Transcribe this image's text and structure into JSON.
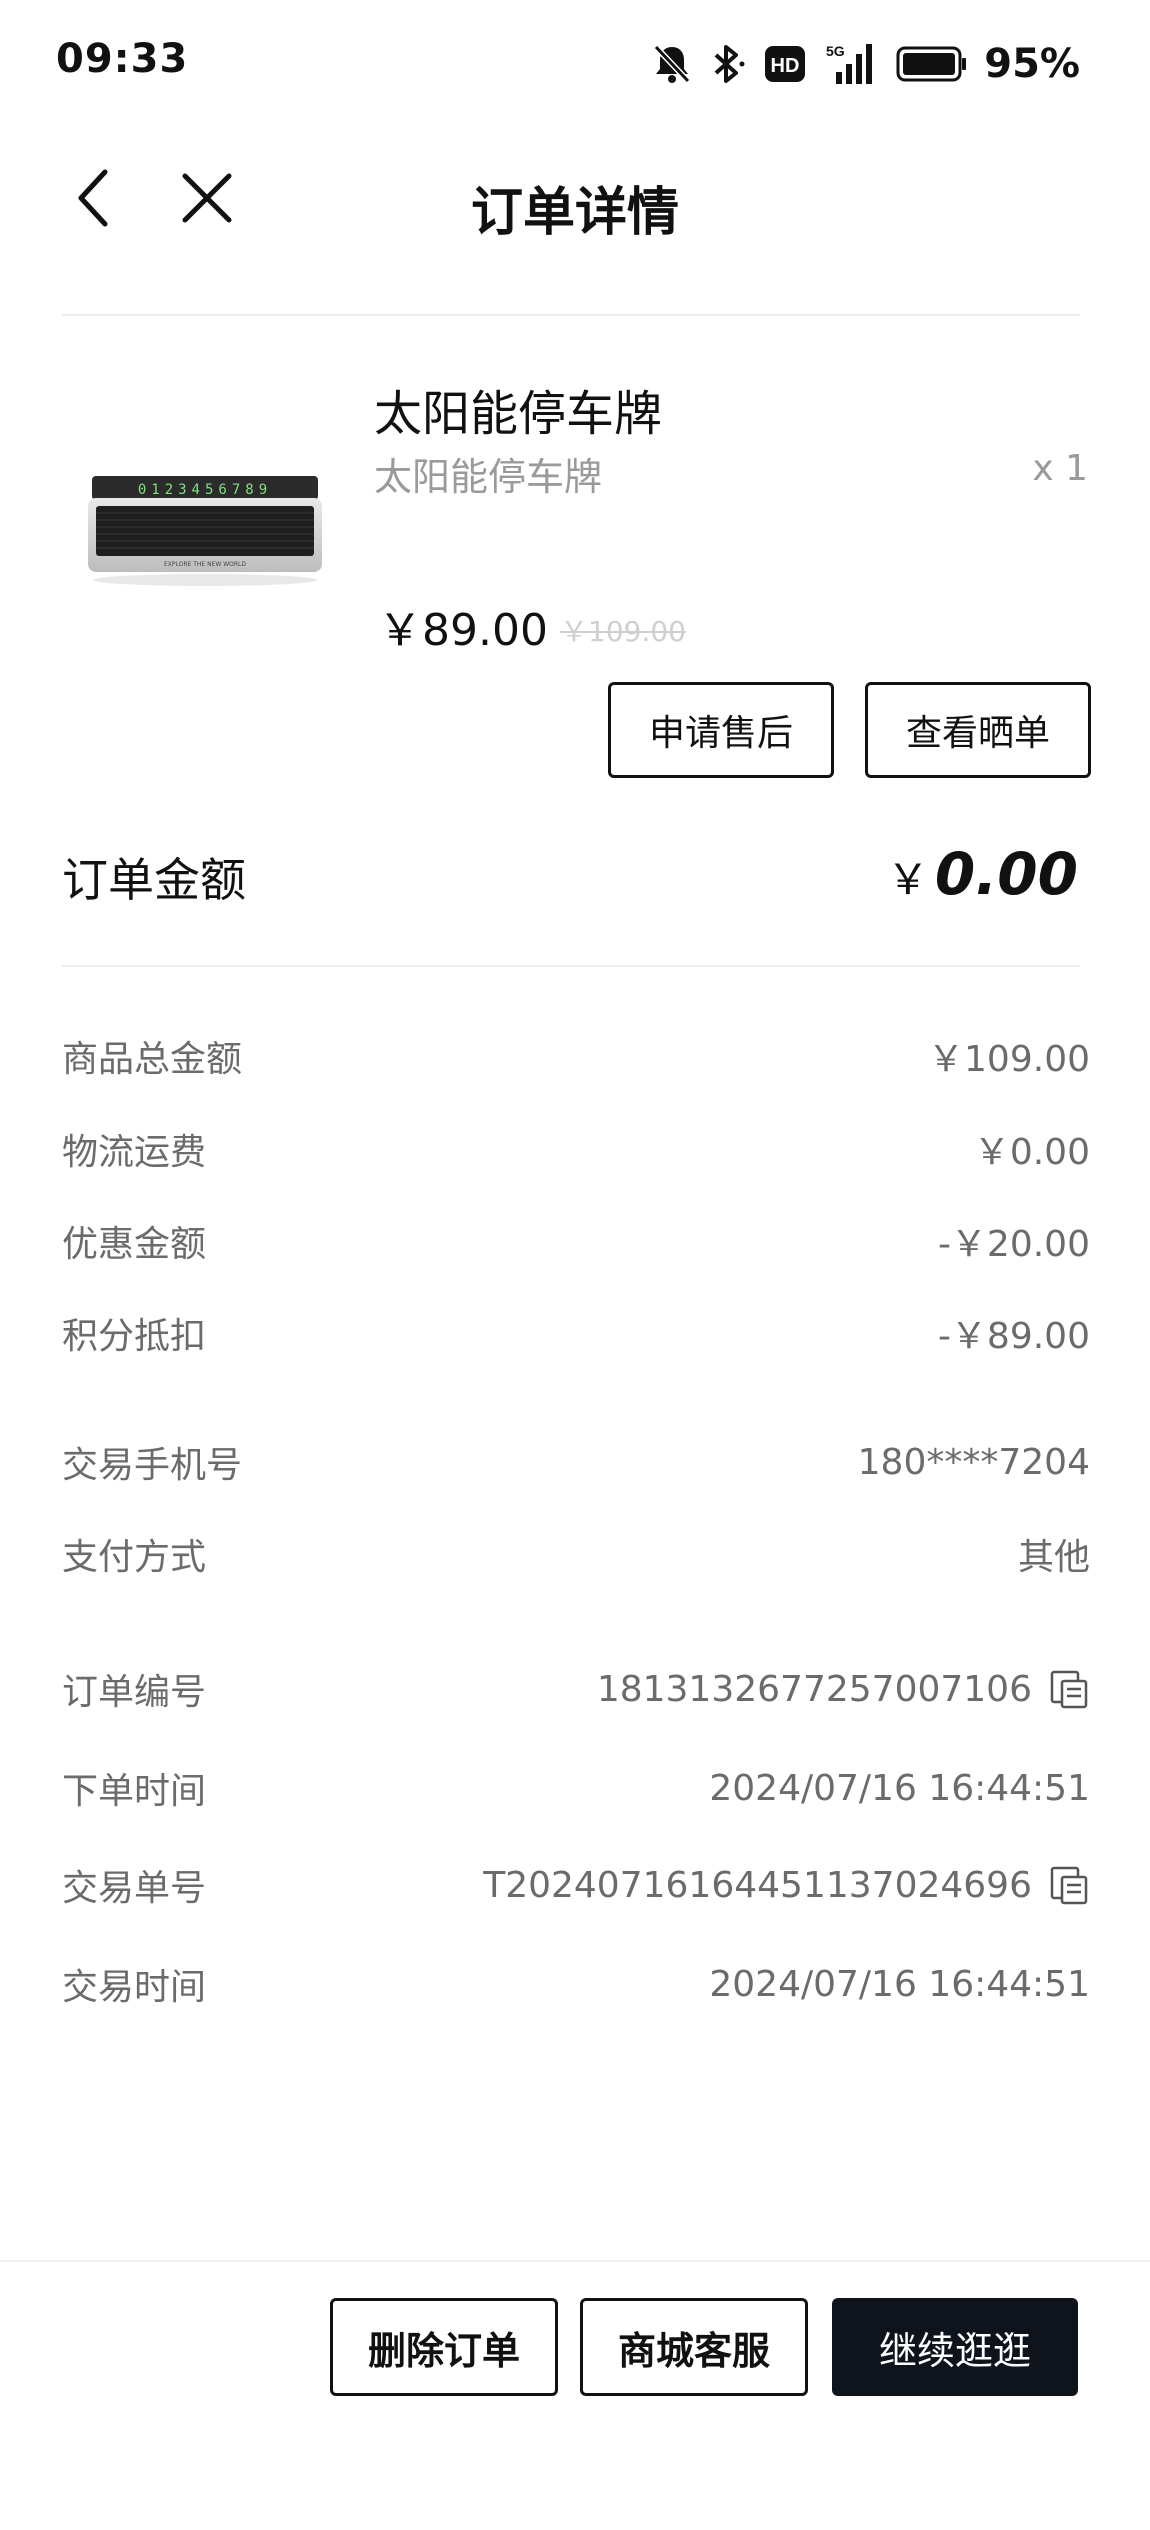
{
  "status_bar": {
    "time": "09:33",
    "battery": "95%",
    "icons": [
      "mute-bell-icon",
      "bluetooth-icon",
      "hd-icon",
      "5g-signal-icon",
      "battery-icon"
    ]
  },
  "nav": {
    "title": "订单详情",
    "back_icon": "chevron-left-icon",
    "close_icon": "close-icon"
  },
  "product": {
    "name": "太阳能停车牌",
    "spec": "太阳能停车牌",
    "quantity": "x 1",
    "price": "￥89.00",
    "original_price": "￥109.00",
    "image_icon": "parking-number-plate-image",
    "plate_digits": "0123456789",
    "plate_caption": "EXPLORE THE NEW WORLD"
  },
  "actions": {
    "after_sale": "申请售后",
    "view_review": "查看晒单"
  },
  "order_amount": {
    "label": "订单金额",
    "currency": "￥",
    "value": "0.00"
  },
  "amounts": [
    {
      "label": "商品总金额",
      "value": "￥109.00"
    },
    {
      "label": "物流运费",
      "value": "￥0.00"
    },
    {
      "label": "优惠金额",
      "value": "-￥20.00"
    },
    {
      "label": "积分抵扣",
      "value": "-￥89.00"
    }
  ],
  "payment": [
    {
      "label": "交易手机号",
      "value": "180****7204"
    },
    {
      "label": "支付方式",
      "value": "其他"
    }
  ],
  "order_info": [
    {
      "label": "订单编号",
      "value": "1813132677257007106",
      "copyable": true
    },
    {
      "label": "下单时间",
      "value": "2024/07/16 16:44:51",
      "copyable": false
    },
    {
      "label": "交易单号",
      "value": "T20240716164451137024696",
      "copyable": true
    },
    {
      "label": "交易时间",
      "value": "2024/07/16 16:44:51",
      "copyable": false
    }
  ],
  "bottom_bar": {
    "delete": "删除订单",
    "service": "商城客服",
    "continue": "继续逛逛"
  },
  "colors": {
    "primary_dark": "#0f141c",
    "muted_text": "#6b6b6b",
    "light_text": "#9a9a9a"
  }
}
